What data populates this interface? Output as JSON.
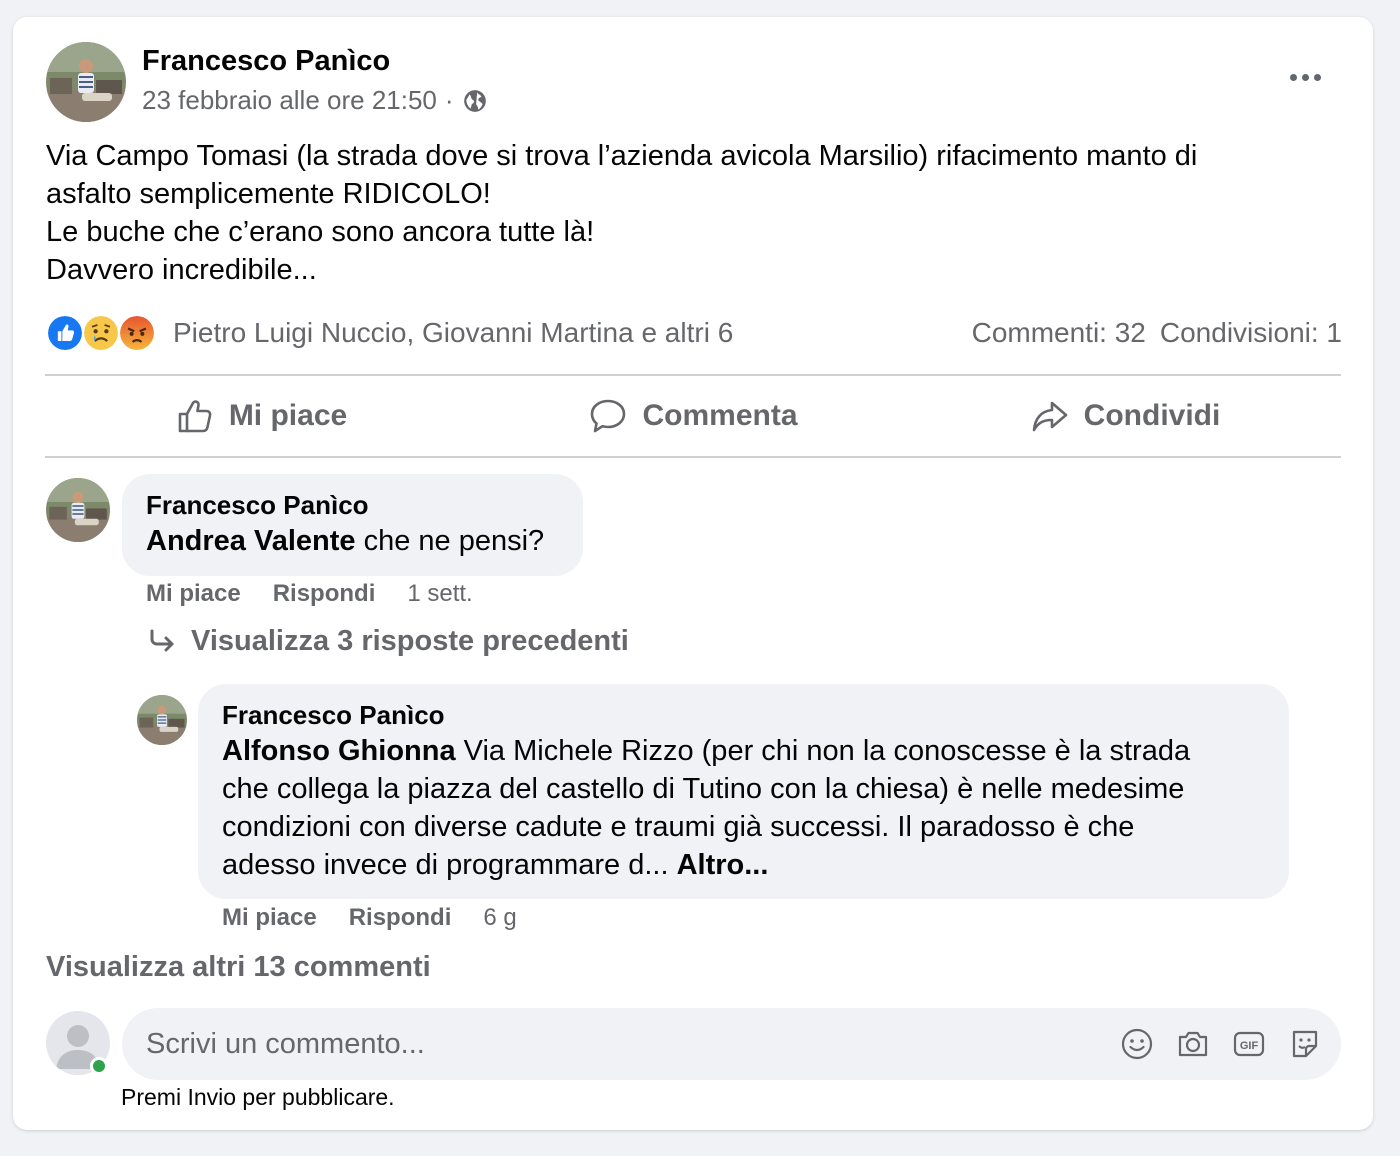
{
  "post": {
    "author": "Francesco Panìco",
    "date": "23 febbraio alle ore 21:50",
    "separator": "·",
    "privacy_icon": "globe-icon",
    "more_icon": "more-dots-icon",
    "text_lines": [
      "Via Campo Tomasi (la strada dove si trova l’azienda avicola Marsilio) rifacimento manto di",
      "asfalto semplicemente RIDICOLO!",
      "Le buche che c’erano sono ancora tutte là!",
      "Davvero incredibile..."
    ]
  },
  "reactions": {
    "icons": [
      "like-reaction-icon",
      "sad-reaction-icon",
      "angry-reaction-icon"
    ],
    "reactors": "Pietro Luigi Nuccio, Giovanni Martina e altri 6",
    "comments_count": "Commenti: 32",
    "shares_count": "Condivisioni: 1"
  },
  "actions": {
    "like": "Mi piace",
    "comment": "Commenta",
    "share": "Condividi"
  },
  "comments": [
    {
      "author": "Francesco Panìco",
      "mention": "Andrea Valente",
      "text": " che ne pensi?",
      "like_label": "Mi piace",
      "reply_label": "Rispondi",
      "time": "1 sett."
    },
    {
      "author": "Francesco Panìco",
      "mention": "Alfonso Ghionna",
      "line1": " Via Michele Rizzo (per chi non la conoscesse è la strada",
      "line2": "che collega la piazza del castello di Tutino con la chiesa) è nelle medesime",
      "line3": "condizioni con diverse cadute e traumi già successi. Il paradosso è che",
      "line4": "adesso invece di programmare d... ",
      "more_label": "Altro...",
      "like_label": "Mi piace",
      "reply_label": "Rispondi",
      "time": "6 g"
    }
  ],
  "view_previous_replies": "Visualizza 3 risposte precedenti",
  "view_more_comments": "Visualizza altri 13 commenti",
  "composer": {
    "placeholder": "Scrivi un commento...",
    "icons": [
      "emoji-icon",
      "camera-icon",
      "gif-icon",
      "sticker-icon"
    ],
    "hint": "Premi Invio per pubblicare."
  },
  "colors": {
    "background": "#f0f2f5",
    "card": "#ffffff",
    "secondary_text": "#65676b",
    "like_blue": "#1877f2",
    "online_green": "#31a24c"
  }
}
